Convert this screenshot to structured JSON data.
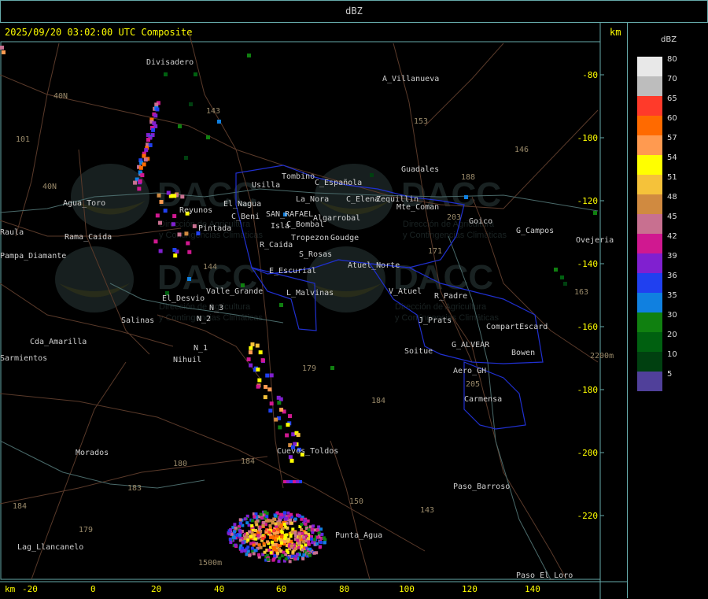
{
  "panel_title": "dBZ",
  "timestamp": "2025/09/20 03:02:00 UTC Composite",
  "km_unit": "km",
  "legend": {
    "title": "dBZ",
    "items": [
      {
        "label": "80",
        "color": "#e8e8e8"
      },
      {
        "label": "70",
        "color": "#bdbdbd"
      },
      {
        "label": "65",
        "color": "#ff3a2a"
      },
      {
        "label": "60",
        "color": "#ff6a00"
      },
      {
        "label": "57",
        "color": "#ff9a50"
      },
      {
        "label": "54",
        "color": "#ffff00"
      },
      {
        "label": "51",
        "color": "#f5c23a"
      },
      {
        "label": "48",
        "color": "#d08a40"
      },
      {
        "label": "45",
        "color": "#c87090"
      },
      {
        "label": "42",
        "color": "#d01890"
      },
      {
        "label": "39",
        "color": "#8020d0"
      },
      {
        "label": "36",
        "color": "#2040f0"
      },
      {
        "label": "35",
        "color": "#1080e0"
      },
      {
        "label": "30",
        "color": "#108010"
      },
      {
        "label": "20",
        "color": "#006010"
      },
      {
        "label": "10",
        "color": "#004010"
      },
      {
        "label": "5",
        "color": "#50409a"
      }
    ]
  },
  "x_ticks": [
    "-20",
    "0",
    "20",
    "40",
    "60",
    "80",
    "100",
    "120",
    "140"
  ],
  "y_ticks": [
    "-80",
    "-100",
    "-120",
    "-140",
    "-160",
    "-180",
    "-200",
    "-220"
  ],
  "places": [
    {
      "name": "Divisadero"
    },
    {
      "name": "A_Villanueva"
    },
    {
      "name": "Guadales"
    },
    {
      "name": "Usilla"
    },
    {
      "name": "Tombino"
    },
    {
      "name": "C_Española"
    },
    {
      "name": "La_Nora"
    },
    {
      "name": "C_Elena"
    },
    {
      "name": "Zequillin"
    },
    {
      "name": "Mte_Coman"
    },
    {
      "name": "Goico"
    },
    {
      "name": "G_Campos"
    },
    {
      "name": "Ovejeria"
    },
    {
      "name": "Agua_Toro"
    },
    {
      "name": "Rama_Caida"
    },
    {
      "name": "Pampa_Diamante"
    },
    {
      "name": "Reyunos"
    },
    {
      "name": "El_Nagua"
    },
    {
      "name": "C_Beni"
    },
    {
      "name": "SAN_RAFAEL"
    },
    {
      "name": "Algarrobal"
    },
    {
      "name": "Pintada"
    },
    {
      "name": "Isla"
    },
    {
      "name": "C_Bombal"
    },
    {
      "name": "Tropezon"
    },
    {
      "name": "Goudge"
    },
    {
      "name": "R_Caida"
    },
    {
      "name": "S_Rosas"
    },
    {
      "name": "Atuel_Norte"
    },
    {
      "name": "E_Escurial"
    },
    {
      "name": "Valle_Grande"
    },
    {
      "name": "L_Malvinas"
    },
    {
      "name": "V_Atuel"
    },
    {
      "name": "R_Padre"
    },
    {
      "name": "El_Desvio"
    },
    {
      "name": "Salinas"
    },
    {
      "name": "N_3"
    },
    {
      "name": "N_2"
    },
    {
      "name": "J_Prats"
    },
    {
      "name": "CompartEscard"
    },
    {
      "name": "G_ALVEAR"
    },
    {
      "name": "Cda_Amarilla"
    },
    {
      "name": "N_1"
    },
    {
      "name": "Nihuil"
    },
    {
      "name": "Soitue"
    },
    {
      "name": "Bowen"
    },
    {
      "name": "Aero_GH"
    },
    {
      "name": "Carmensa"
    },
    {
      "name": "Morados"
    },
    {
      "name": "Cuevos_Toldos"
    },
    {
      "name": "Paso_Barroso"
    },
    {
      "name": "Punta_Agua"
    },
    {
      "name": "Lag_Llancanelo"
    },
    {
      "name": "Paso_El_Loro"
    },
    {
      "name": "Sarmientos"
    },
    {
      "name": "Raula"
    }
  ],
  "route_numbers": [
    "143",
    "153",
    "146",
    "101",
    "40N",
    "40N",
    "188",
    "203",
    "171",
    "144",
    "179",
    "184",
    "180",
    "184",
    "183",
    "184",
    "179",
    "150",
    "143",
    "205",
    "163",
    "2200m",
    "1500m"
  ],
  "watermark": {
    "brand": "DACC",
    "line1": "Dirección de Agricultura",
    "line2": "y Contingencias Climáticas"
  }
}
